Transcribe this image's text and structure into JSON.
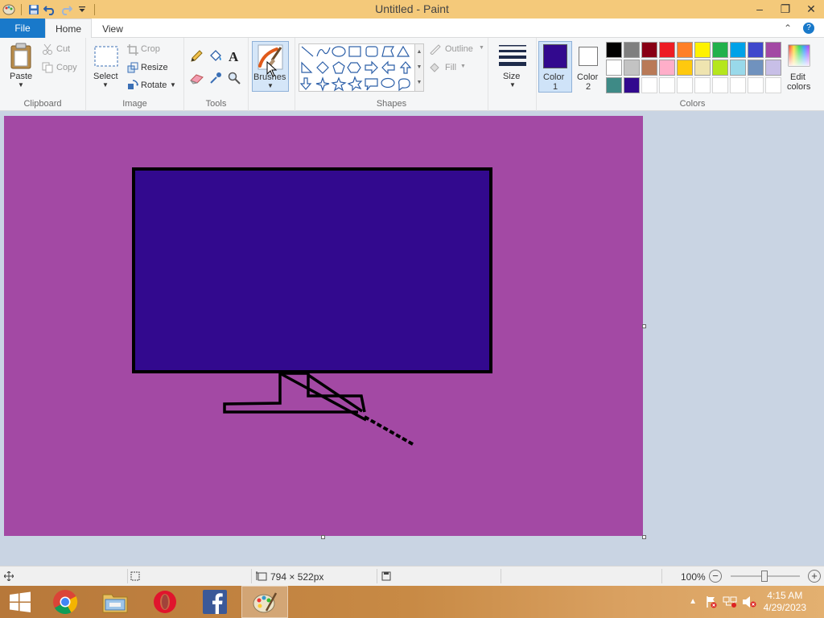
{
  "window": {
    "title": "Untitled - Paint",
    "controls": {
      "minimize": "–",
      "restore": "❐",
      "close": "✕"
    }
  },
  "tabs": {
    "file": "File",
    "home": "Home",
    "view": "View"
  },
  "ribbon": {
    "clipboard": {
      "label": "Clipboard",
      "paste": "Paste",
      "cut": "Cut",
      "copy": "Copy"
    },
    "image": {
      "label": "Image",
      "select": "Select",
      "crop": "Crop",
      "resize": "Resize",
      "rotate": "Rotate"
    },
    "tools": {
      "label": "Tools"
    },
    "brushes": {
      "label": "Brushes"
    },
    "shapes": {
      "label": "Shapes",
      "outline": "Outline",
      "fill": "Fill"
    },
    "size": {
      "label": "Size"
    },
    "color1": {
      "label_line1": "Color",
      "label_line2": "1",
      "value": "#32098e"
    },
    "color2": {
      "label_line1": "Color",
      "label_line2": "2",
      "value": "#ffffff"
    },
    "colors": {
      "label": "Colors",
      "edit_line1": "Edit",
      "edit_line2": "colors",
      "palette": [
        "#000000",
        "#7f7f7f",
        "#880015",
        "#ed1c24",
        "#ff7f27",
        "#fff200",
        "#22b14c",
        "#00a2e8",
        "#3f48cc",
        "#a349a4",
        "#ffffff",
        "#c3c3c3",
        "#b97a57",
        "#ffaec9",
        "#ffc90e",
        "#efe4b0",
        "#b5e61d",
        "#99d9ea",
        "#7092be",
        "#c8bfe7",
        "#3e8a86",
        "#32098e",
        "",
        "",
        "",
        "",
        "",
        "",
        "",
        ""
      ]
    }
  },
  "canvas": {
    "background": "#a349a4",
    "monitor_screen_color": "#32098e",
    "outline_color": "#000000"
  },
  "statusbar": {
    "dimensions": "794 × 522px",
    "zoom": "100%"
  },
  "taskbar": {
    "apps": [
      "windows-start",
      "chrome",
      "file-explorer",
      "opera",
      "facebook",
      "paint"
    ],
    "time": "4:15 AM",
    "date": "4/29/2023"
  }
}
